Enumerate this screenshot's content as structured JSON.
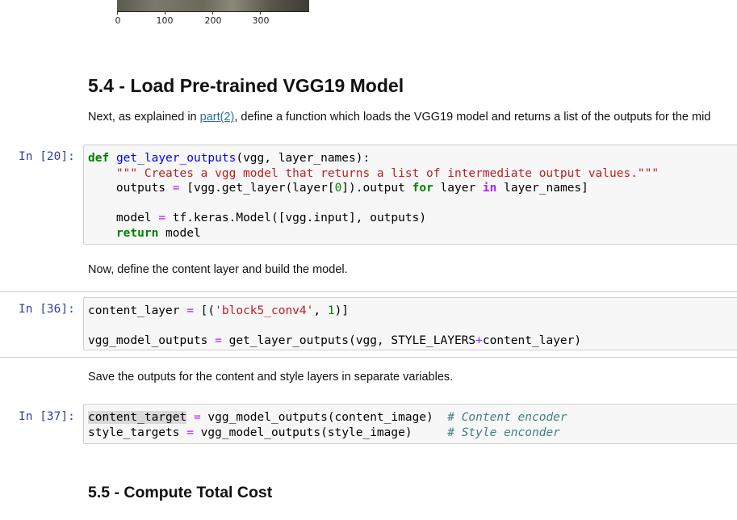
{
  "plot": {
    "tick_labels": [
      "0",
      "100",
      "200",
      "300"
    ]
  },
  "section_54": {
    "heading": "5.4 - Load Pre-trained VGG19 Model",
    "text_before_link": "Next, as explained in ",
    "link_text": "part(2)",
    "text_after_link": ", define a function which loads the VGG19 model and returns a list of the outputs for the mid"
  },
  "cell_20": {
    "prompt": "In [20]:",
    "lines": [
      "def get_layer_outputs(vgg, layer_names):",
      "    \"\"\" Creates a vgg model that returns a list of intermediate output values.\"\"\"",
      "    outputs = [vgg.get_layer(layer[0]).output for layer in layer_names]",
      "",
      "    model = tf.keras.Model([vgg.input], outputs)",
      "    return model"
    ]
  },
  "md_content_layer": {
    "text": "Now, define the content layer and build the model."
  },
  "cell_36": {
    "prompt": "In [36]:",
    "lines": [
      "content_layer = [('block5_conv4', 1)]",
      "",
      "vgg_model_outputs = get_layer_outputs(vgg, STYLE_LAYERS+content_layer)"
    ]
  },
  "md_save_outputs": {
    "text": "Save the outputs for the content and style layers in separate variables."
  },
  "cell_37": {
    "prompt": "In [37]:",
    "lines": [
      "content_target = vgg_model_outputs(content_image)  # Content encoder",
      "style_targets = vgg_model_outputs(style_image)     # Style enconder"
    ]
  },
  "section_55": {
    "heading": "5.5 - Compute Total Cost"
  }
}
